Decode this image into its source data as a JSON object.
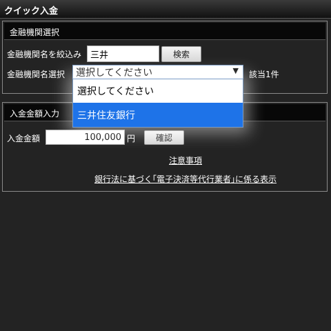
{
  "header": {
    "title": "クイック入金"
  },
  "bank_select": {
    "section_title": "金融機関選択",
    "filter_label": "金融機関名を絞込み",
    "filter_value": "三井",
    "search_button": "検索",
    "select_label": "金融機関名選択",
    "selected_value": "選択してください",
    "dropdown_arrow": "▼",
    "match_count": "該当1件",
    "options": [
      "選択してください",
      "三井住友銀行"
    ]
  },
  "amount": {
    "section_title": "入金金額入力",
    "amount_label": "入金金額",
    "amount_value": "100,000",
    "unit": "円",
    "confirm_button": "確認",
    "notice_link": "注意事項",
    "legal_link": "銀行法に基づく｢電子決済等代行業者｣に係る表示"
  }
}
